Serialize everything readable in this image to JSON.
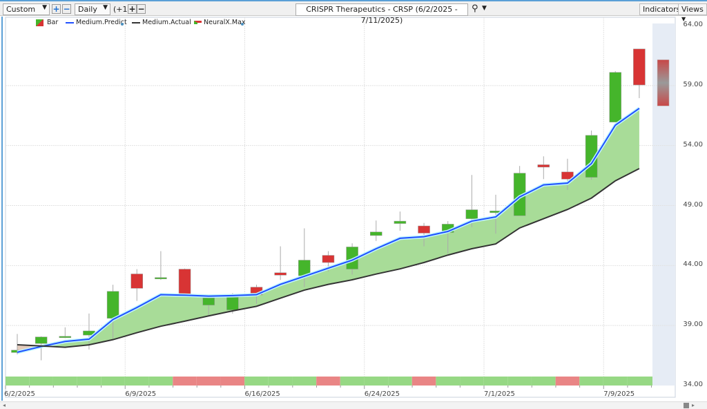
{
  "toolbar": {
    "period": "Custom",
    "interval": "Daily",
    "offset": "(+1)",
    "title": "CRISPR Therapeutics - CRSP (6/2/2025 - 7/11/2025)",
    "indicators": "Indicators",
    "views": "Views",
    "plus": "+",
    "minus": "−"
  },
  "legend": {
    "bar": "Bar",
    "predict": "Medium.Predict",
    "actual": "Medium.Actual",
    "neural": "NeuralX.Max"
  },
  "colors": {
    "up": "#45b52b",
    "down": "#d83434",
    "predict": "#1f4fff",
    "actual": "#333333",
    "fill": "#a8dc98",
    "signal_up": "#96d884",
    "signal_down": "#e98585"
  },
  "chart_data": {
    "type": "candlestick",
    "title": "CRISPR Therapeutics - CRSP (6/2/2025 - 7/11/2025)",
    "ylim": [
      34,
      64
    ],
    "yticks": [
      "64.00",
      "59.00",
      "54.00",
      "49.00",
      "44.00",
      "39.00",
      "34.00"
    ],
    "xticks": [
      "6/2/2025",
      "6/9/2025",
      "6/16/2025",
      "6/24/2025",
      "7/1/2025",
      "7/9/2025"
    ],
    "candles": [
      [
        36.75,
        38.3,
        36.6,
        36.95
      ],
      [
        37.5,
        38.1,
        36.1,
        38.05
      ],
      [
        38.05,
        38.85,
        37.95,
        38.1
      ],
      [
        38.2,
        40.0,
        37.0,
        38.55
      ],
      [
        39.6,
        42.4,
        37.9,
        41.85
      ],
      [
        43.3,
        43.7,
        41.05,
        42.1
      ],
      [
        42.9,
        45.2,
        42.8,
        43.0
      ],
      [
        43.7,
        43.75,
        41.5,
        41.55
      ],
      [
        40.7,
        41.3,
        39.85,
        41.3
      ],
      [
        40.3,
        41.7,
        40.0,
        41.35
      ],
      [
        42.2,
        42.4,
        40.8,
        41.55
      ],
      [
        43.4,
        45.6,
        42.8,
        43.2
      ],
      [
        43.15,
        47.1,
        42.2,
        44.45
      ],
      [
        44.85,
        45.2,
        43.5,
        44.25
      ],
      [
        43.7,
        45.85,
        43.25,
        45.55
      ],
      [
        46.5,
        47.75,
        46.05,
        46.8
      ],
      [
        47.5,
        48.5,
        46.9,
        47.7
      ],
      [
        47.3,
        47.55,
        45.6,
        46.7
      ],
      [
        46.75,
        47.7,
        45.0,
        47.45
      ],
      [
        47.9,
        51.55,
        47.2,
        48.65
      ],
      [
        48.4,
        49.9,
        46.65,
        48.55
      ],
      [
        48.15,
        52.3,
        48.15,
        51.7
      ],
      [
        52.4,
        53.1,
        51.2,
        52.2
      ],
      [
        51.8,
        52.9,
        50.3,
        51.2
      ],
      [
        51.35,
        55.25,
        51.15,
        54.85
      ],
      [
        55.95,
        60.2,
        55.95,
        60.1
      ],
      [
        62.05,
        62.05,
        57.95,
        59.05
      ]
    ],
    "forecast_range": [
      57.3,
      61.15
    ],
    "medium_predict": [
      36.77,
      37.25,
      37.67,
      37.86,
      39.5,
      40.5,
      41.57,
      41.53,
      41.45,
      41.49,
      41.57,
      42.43,
      43.1,
      43.78,
      44.45,
      45.4,
      46.27,
      46.4,
      46.84,
      47.7,
      48.05,
      49.72,
      50.72,
      50.87,
      52.5,
      55.7,
      57.1
    ],
    "medium_actual": [
      37.4,
      37.3,
      37.19,
      37.39,
      37.82,
      38.4,
      38.94,
      39.36,
      39.8,
      40.22,
      40.6,
      41.28,
      41.95,
      42.43,
      42.81,
      43.29,
      43.72,
      44.25,
      44.87,
      45.4,
      45.8,
      47.13,
      47.9,
      48.67,
      49.62,
      51.06,
      52.08
    ],
    "neuralx_signal": [
      "up",
      "up",
      "up",
      "up",
      "up",
      "up",
      "up",
      "down",
      "down",
      "down",
      "up",
      "up",
      "up",
      "down",
      "up",
      "up",
      "up",
      "down",
      "up",
      "up",
      "up",
      "up",
      "up",
      "down",
      "up",
      "up",
      "up"
    ]
  }
}
